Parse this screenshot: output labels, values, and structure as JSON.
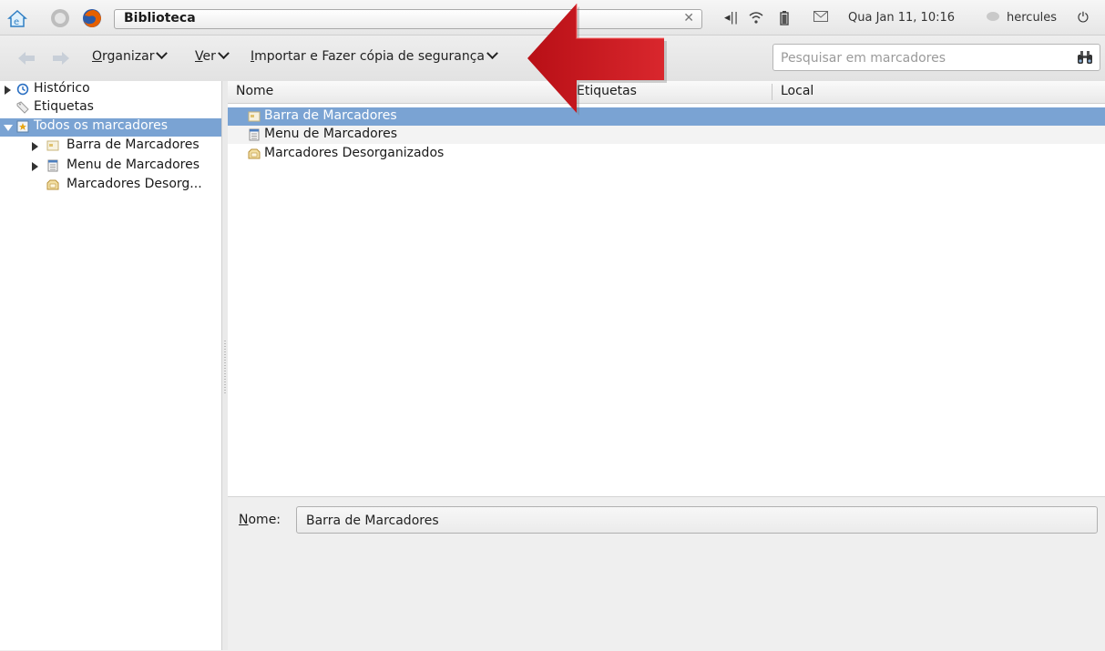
{
  "window": {
    "title": "Biblioteca",
    "icons": [
      "home-icon",
      "system-menu-icon",
      "firefox-icon",
      "close-icon"
    ]
  },
  "tray": {
    "datetime": "Qua Jan 11, 10:16",
    "user": "hercules",
    "icons": [
      "volume-icon",
      "wifi-icon",
      "battery-icon",
      "mail-icon",
      "chat-status-icon",
      "power-icon"
    ]
  },
  "toolbar": {
    "menus": [
      {
        "label": "Organizar",
        "accel": "O",
        "rest": "rganizar"
      },
      {
        "label": "Ver",
        "accel": "V",
        "rest": "er"
      },
      {
        "label": "Importar e Fazer cópia de segurança",
        "accel": "I",
        "rest": "mportar e Fazer cópia de segurança"
      }
    ],
    "search_placeholder": "Pesquisar em marcadores"
  },
  "sidebar": {
    "items": [
      {
        "label": "Histórico",
        "icon": "clock-icon",
        "expander": "closed"
      },
      {
        "label": "Etiquetas",
        "icon": "tag-icon",
        "expander": "none"
      },
      {
        "label": "Todos os marcadores",
        "icon": "star-folder-icon",
        "expander": "open",
        "selected": true
      },
      {
        "label": "Barra de Marcadores",
        "icon": "toolbar-folder-icon",
        "expander": "closed"
      },
      {
        "label": "Menu de Marcadores",
        "icon": "menu-folder-icon",
        "expander": "closed"
      },
      {
        "label": "Marcadores Desorg...",
        "icon": "unsorted-folder-icon",
        "expander": "none"
      }
    ]
  },
  "list": {
    "columns": [
      "Nome",
      "Etiquetas",
      "Local"
    ],
    "rows": [
      {
        "name": "Barra de Marcadores",
        "icon": "toolbar-folder-icon",
        "selected": true
      },
      {
        "name": "Menu de Marcadores",
        "icon": "menu-folder-icon"
      },
      {
        "name": "Marcadores Desorganizados",
        "icon": "unsorted-folder-icon"
      }
    ]
  },
  "details": {
    "name_label_accel": "N",
    "name_label_rest": "ome:",
    "name_value": "Barra de Marcadores"
  },
  "colors": {
    "selection": "#7aa3d3",
    "annotation_arrow": "#c8161d"
  }
}
